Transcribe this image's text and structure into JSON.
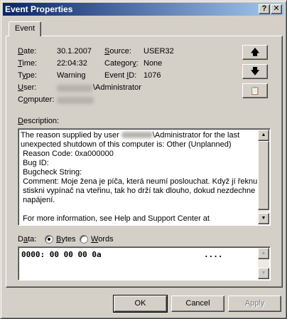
{
  "window": {
    "title": "Event Properties",
    "help_glyph": "?",
    "close_glyph": "✕"
  },
  "tabs": [
    {
      "label": "Event"
    }
  ],
  "fields": {
    "date_label": "Date:",
    "date_value": "30.1.2007",
    "source_label": "Source:",
    "source_value": "USER32",
    "time_label": "Time:",
    "time_value": "22:04:32",
    "category_label": "Category:",
    "category_value": "None",
    "type_label": "Type:",
    "type_value": "Warning",
    "eventid_label": "Event ID:",
    "eventid_value": "1076",
    "user_label": "User:",
    "user_value": "\\Administrator",
    "computer_label": "Computer:"
  },
  "side_buttons": {
    "up": "🡅",
    "down": "🡇",
    "copy": "📋"
  },
  "description": {
    "label": "Description:",
    "line1_before": "The reason supplied by user ",
    "line1_after": "\\Administrator for the last",
    "body": "unexpected shutdown of this computer is: Other (Unplanned)\n Reason Code: 0xa000000\n Bug ID:\n Bugcheck String:\n Comment: Moje žena je píča, která neumí poslouchat. Když jí řeknu\n stiskni vypínač na vteřinu, tak ho drží tak dlouho, dokud nezdechne\n napájení.\n\n For more information, see Help and Support Center at"
  },
  "data_section": {
    "label": "Data:",
    "option_bytes": "Bytes",
    "option_words": "Words",
    "selected": "Bytes",
    "hex_line": "0000: 00 00 00 0a",
    "ascii_line": "...."
  },
  "buttons": {
    "ok": "OK",
    "cancel": "Cancel",
    "apply": "Apply"
  }
}
